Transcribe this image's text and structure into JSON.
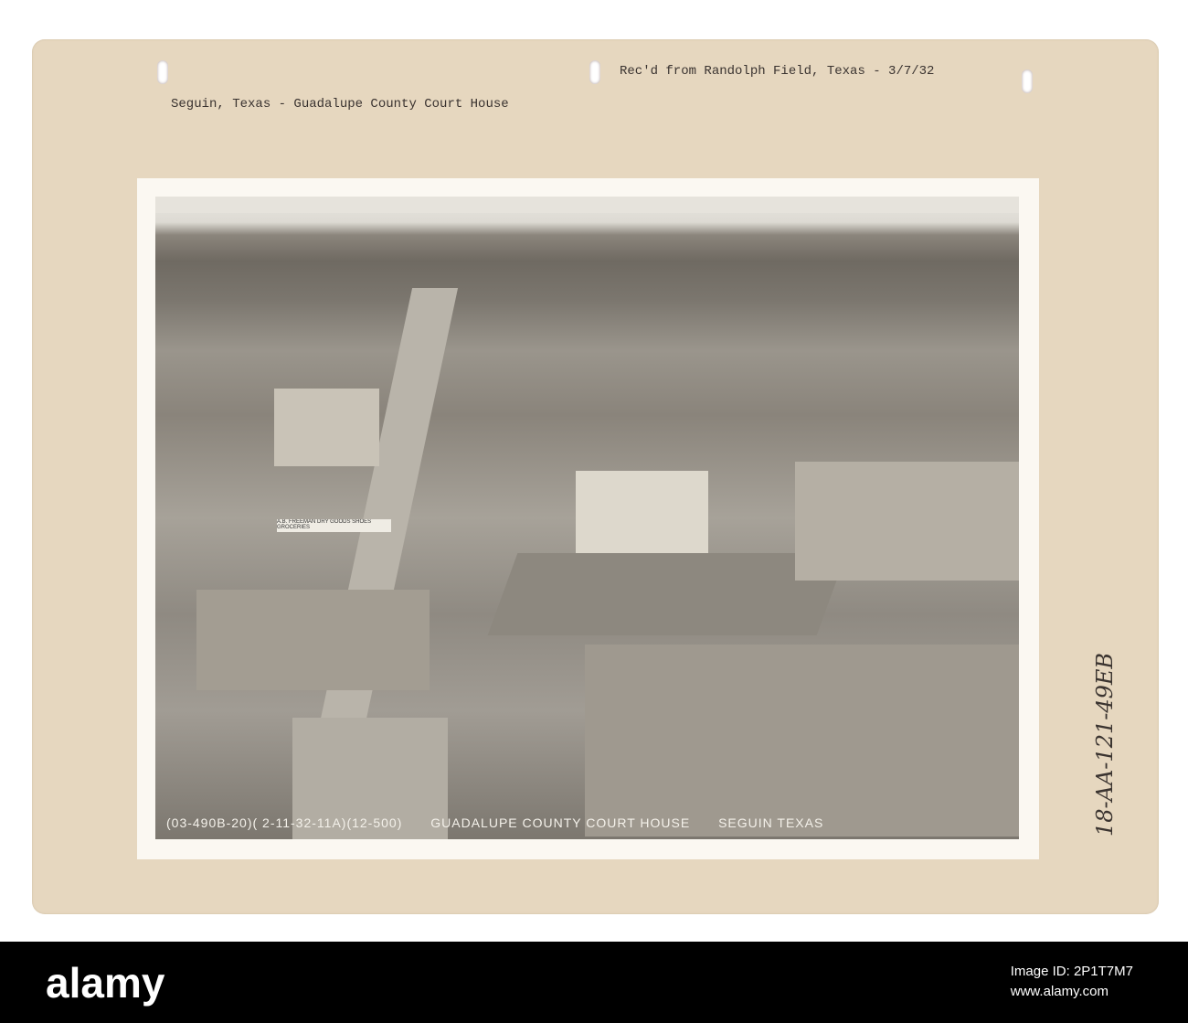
{
  "card": {
    "received_note": "Rec'd from Randolph Field, Texas - 3/7/32",
    "title": "Seguin, Texas - Guadalupe County Court House",
    "handwritten_id": "18-AA-121-49EB"
  },
  "photo": {
    "caption_code": "(03-490B-20)( 2-11-32-11A)(12-500)",
    "caption_subject": "GUADALUPE COUNTY COURT HOUSE",
    "caption_place": "SEGUIN TEXAS",
    "sign_text": "A.B. FREEMAN DRY GOODS SHOES GROCERIES"
  },
  "watermark_bar": {
    "logo": "alamy",
    "image_id": "Image ID: 2P1T7M7",
    "url": "www.alamy.com"
  }
}
